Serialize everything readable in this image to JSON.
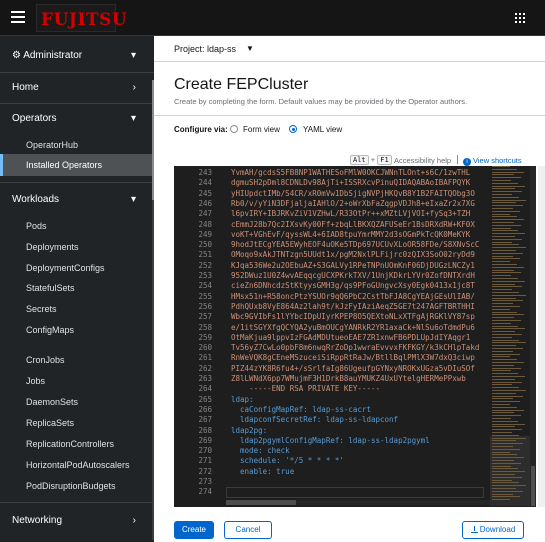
{
  "masthead": {
    "logo_text": "FUJITSU",
    "apps_icon": "grid-icon",
    "menu_icon": "hamburger-icon"
  },
  "sidebar": {
    "perspective": "Administrator",
    "sections": {
      "home": "Home",
      "operators": "Operators",
      "workloads": "Workloads",
      "networking": "Networking"
    },
    "operators_items": [
      "OperatorHub",
      "Installed Operators"
    ],
    "workloads_items": [
      "Pods",
      "Deployments",
      "DeploymentConfigs",
      "StatefulSets",
      "Secrets",
      "ConfigMaps",
      "CronJobs",
      "Jobs",
      "DaemonSets",
      "ReplicaSets",
      "ReplicationControllers",
      "HorizontalPodAutoscalers",
      "PodDisruptionBudgets"
    ],
    "active_item": "Installed Operators"
  },
  "project": {
    "label": "Project: ldap-ss"
  },
  "page": {
    "title": "Create FEPCluster",
    "subtitle": "Create by completing the form. Default values may be provided by the Operator authors.",
    "configure_via": "Configure via:",
    "form_view": "Form view",
    "yaml_view": "YAML view",
    "selected_view": "YAML view"
  },
  "editor_help": {
    "kbd_alt": "Alt",
    "kbd_plus": "+",
    "kbd_f1": "F1",
    "accessibility_help": "Accessibility help",
    "view_shortcuts": "View shortcuts"
  },
  "editor": {
    "lines": [
      {
        "n": "243",
        "t": "YvmAH/gcdsS5FB8NP1WATHESoFMlW0OKCJWNnTLOnt+s6C/1zwTHL"
      },
      {
        "n": "244",
        "t": "dgmuSH2pDml8CDNLDv98AjTi+ISSRXcvPinuQIDAQABAoIBAFPQYK"
      },
      {
        "n": "245",
        "t": "yHIUpdctIMb/S4CR/xR0mVw1DbSjigNVPjHKQvB8Y1B2FAITQObg3O"
      },
      {
        "n": "246",
        "t": "Rb0/v/yYiN3DFjaljaIAHlO/2+oWrXbFaZqgpVDJh8+eIxaZr2x7XG"
      },
      {
        "n": "247",
        "t": "l6pvIRY+IBJRKvZiV1VZHwL/R33OtPr++xMZtLVjVOI+fySq3+TZH"
      },
      {
        "n": "248",
        "t": "cEmmJ28b7Qc2IXsvKy00Ff+zbqLlBKXQZAFUSeEr1BsDRXdRW+KF0X"
      },
      {
        "n": "249",
        "t": "voKT+VGhEvF/qyssWL4+6IAD8tpuYmrMMY2d3sOGmPkTcQK0MeKYK"
      },
      {
        "n": "250",
        "t": "9hodJtECgYEA5EWyhEOF4uOKe5TDp697UCUvXLoOR58FDe/S8XNvScC"
      },
      {
        "n": "251",
        "t": "OMoqo9xAkJTNTzgn5UUdt1x/pgM2NxlPLFijrc0zQIX3SoO02ryDd9"
      },
      {
        "n": "252",
        "t": "KJqa536We2u2OEbuAZ+S3GALVy1RPeTNPnUOmKnF06DjDUGzLNCZy1"
      },
      {
        "n": "253",
        "t": "952DWuz1U0Z4wvAEqqcgUCXPKrkTXV/1UnjKDkrLYVr0ZofDNTXrdH"
      },
      {
        "n": "254",
        "t": "cieZn6DNhcdzStKtyysGMH3g/qs9PFoGUngvcXsy0Egk0413x1jc8T"
      },
      {
        "n": "255",
        "t": "HMsx51n+R58oncPtzYSUOr9qQ6PbC2CstTbFJA8CgYEAjGEsUlIAB/"
      },
      {
        "n": "256",
        "t": "PdhQUxb8VyE864Az2lah9t/kJzFyIAziAeqZ5GE7t247AGFTBRTHHI"
      },
      {
        "n": "257",
        "t": "Wbc9GVIbFs1lYYbcIDpUIyrKPEP8O5QEXtoNLxXTFgAjRGKlVY87sp"
      },
      {
        "n": "258",
        "t": "e/1itSGYXfgQCYQA2yuBmOUCgYANRkR2YR1axaCk+NlSu6oTdmdPu6"
      },
      {
        "n": "259",
        "t": "OtMaKjua9lppvIzFGAdMDUtueoEAE7ZR1xnwFB6PDLUpJdIYAqgr1"
      },
      {
        "n": "260",
        "t": "Tv56yZ7CwLo0pbF8m6nwqRrZoDp1wwraEvvvxFKFKGY/k3kCHlpTakd"
      },
      {
        "n": "261",
        "t": "RnWeVQK8gCEneMSzuceiSiRppRtRaJw/BtllBqlPMlX3W7dxQ3ciwp"
      },
      {
        "n": "262",
        "t": "PIZ44zYK8R6fu4+/sSrlfaIg86UgeufpGYNxyNROKxUGza5vDIuSOf"
      },
      {
        "n": "263",
        "t": "Z8lLWNdX6pp7WMujmF3H1DrkB8auYMUKZ4UxUYtelgHERMePPxwb"
      },
      {
        "n": "264",
        "t": "    -----END RSA PRIVATE KEY-----"
      },
      {
        "n": "265",
        "t": "ldap:"
      },
      {
        "n": "266",
        "t": "  caConfigMapRef: ldap-ss-cacrt"
      },
      {
        "n": "267",
        "t": "  ldapconfSecretRef: ldap-ss-ldapconf"
      },
      {
        "n": "268",
        "t": "ldap2pg:"
      },
      {
        "n": "269",
        "t": "  ldap2pgymlConfigMapRef: ldap-ss-ldap2pgyml"
      },
      {
        "n": "270",
        "t": "  mode: check"
      },
      {
        "n": "271",
        "t": "  schedule: '*/5 * * * *'"
      },
      {
        "n": "272",
        "t": "  enable: true"
      },
      {
        "n": "273",
        "t": ""
      },
      {
        "n": "274",
        "t": ""
      }
    ]
  },
  "footer": {
    "create": "Create",
    "cancel": "Cancel",
    "download": "Download"
  },
  "colors": {
    "primary": "#0066cc",
    "sidebar_bg": "#212427",
    "editor_bg": "#1e1e1e",
    "logo_red": "#d40000"
  }
}
